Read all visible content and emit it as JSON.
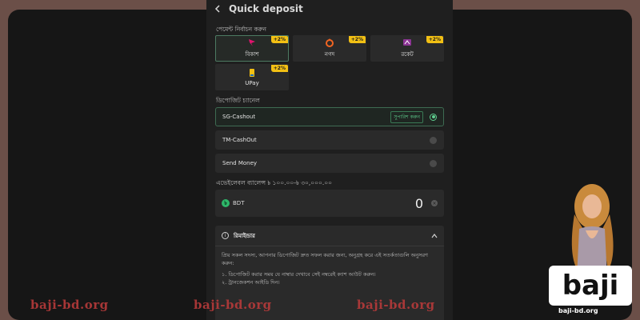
{
  "header": {
    "title": "Quick deposit"
  },
  "payment": {
    "label": "পেমেন্ট নির্বাচন করুন",
    "methods": [
      {
        "name": "বিকাশ",
        "badge": "+2%",
        "selected": true,
        "color": "#e2136e"
      },
      {
        "name": "নগদ",
        "badge": "+2%",
        "selected": false,
        "color": "#f26522"
      },
      {
        "name": "রকেট",
        "badge": "+2%",
        "selected": false,
        "color": "#8c3494"
      },
      {
        "name": "UPay",
        "badge": "+2%",
        "selected": false,
        "color": "#f2c014"
      }
    ]
  },
  "channel": {
    "label": "ডিপোজিট চ্যানেল",
    "options": [
      {
        "name": "SG-Cashout",
        "tag": "সুপারিশ করুন",
        "selected": true
      },
      {
        "name": "TM-CashOut",
        "tag": "",
        "selected": false
      },
      {
        "name": "Send Money",
        "tag": "",
        "selected": false
      }
    ]
  },
  "amount": {
    "label": "এভেইলেবল ব্যালেন্স ৳ ১০০.০০-৳ ৩০,০০০.০০",
    "currency": "BDT",
    "currency_symbol": "৳",
    "value": "0"
  },
  "reminder": {
    "title": "রিমাইন্ডার",
    "intro": "প্রিয় সকল সদস্য, আপনার ডিপোজিট দ্রুত সফল করার জন্য, অনুগ্রহ করে এই সতর্কতাগুলি অনুসরণ করুন:",
    "lines": [
      "১. ডিপোজিট করার সময় যে নাম্বার দেখাবে সেই নম্বরেই ক্যাশ আউট করুন।",
      "২. ট্রানজেকশন আইডি দিন।"
    ]
  },
  "watermarks": [
    "baji-bd.org",
    "baji-bd.org",
    "baji-bd.org"
  ],
  "brand": {
    "logo": "baji",
    "url": "baji-bd.org"
  }
}
